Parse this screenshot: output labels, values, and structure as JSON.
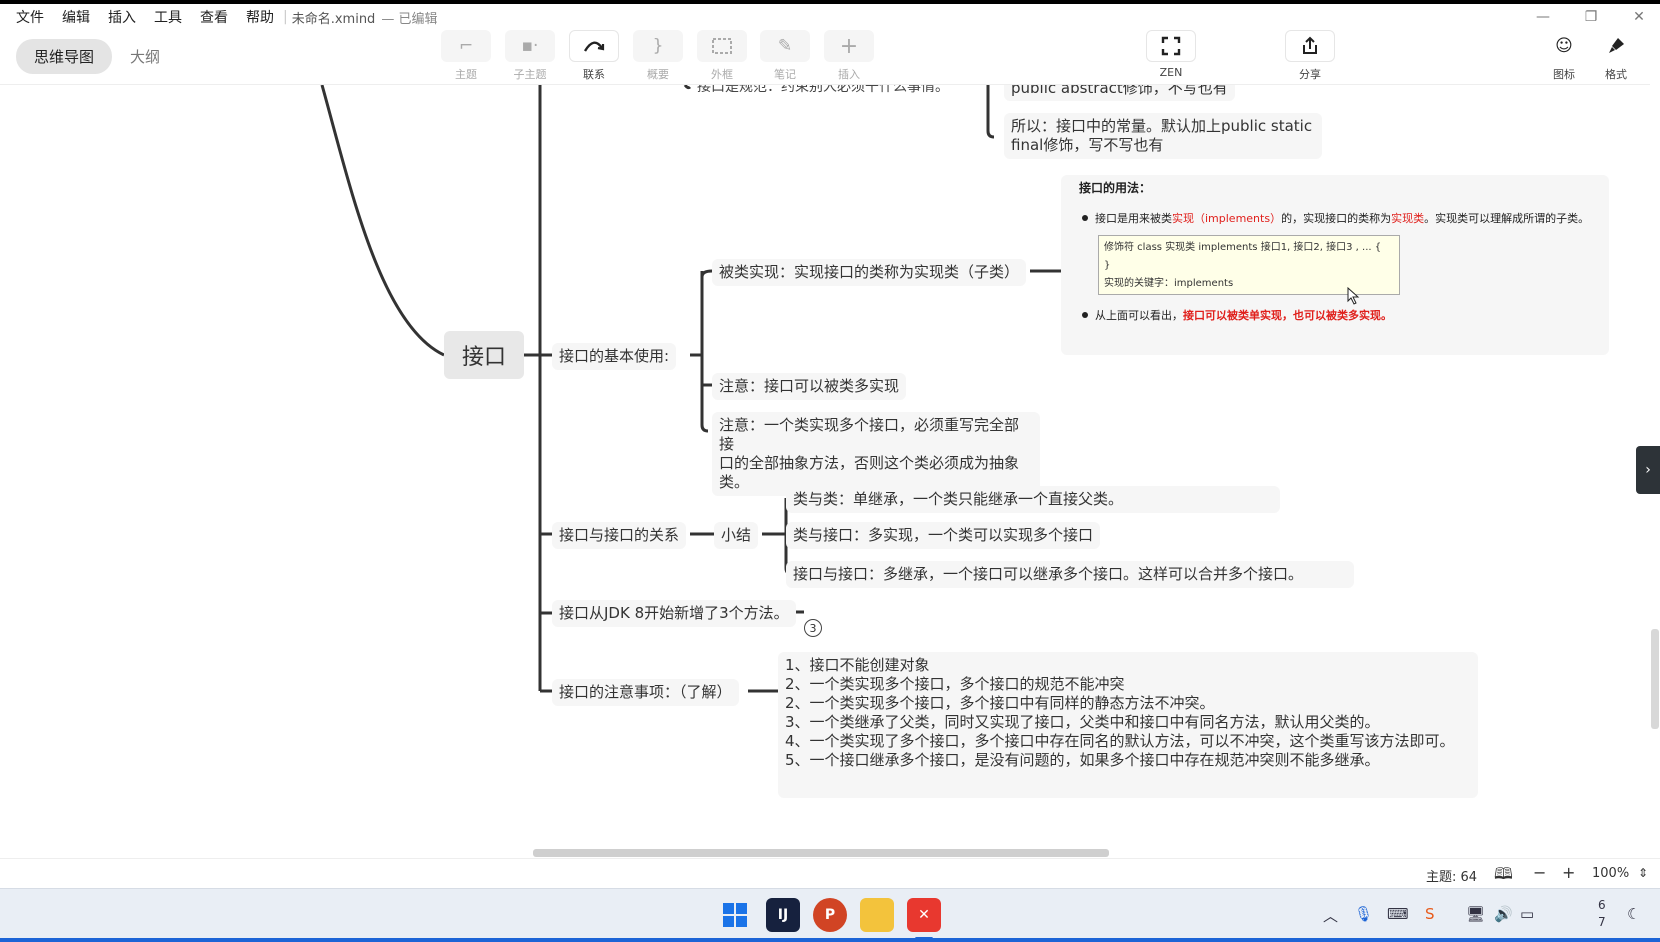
{
  "menu": {
    "items": [
      "文件",
      "编辑",
      "插入",
      "工具",
      "查看",
      "帮助"
    ],
    "filename": "未命名.xmind",
    "status": "— 已编辑"
  },
  "window_controls": {
    "minimize": "—",
    "maximize": "❐",
    "close": "✕"
  },
  "view_switch": {
    "mindmap": "思维导图",
    "outline": "大纲"
  },
  "toolbar": {
    "topic": "主题",
    "subtopic": "子主题",
    "relation": "联系",
    "summary": "概要",
    "boundary": "外框",
    "note": "笔记",
    "insert": "插入",
    "zen": "ZEN",
    "share": "分享",
    "icon": "图标",
    "format": "格式"
  },
  "map": {
    "central": "接口",
    "top_partial_1": "接口是规范：约束别人必须干什么事情。",
    "top_partial_2": "public abstract修饰，不写也有",
    "top_constant_1": "所以：接口中的常量。默认加上public static",
    "top_constant_2": "final修饰，写不写也有",
    "basic_use": "接口的基本使用:",
    "implemented": "被类实现：实现接口的类称为实现类（子类）",
    "attention_1": "注意：接口可以被类多实现",
    "attention_2_l1": "注意：一个类实现多个接口，必须重写完全部接",
    "attention_2_l2": "口的全部抽象方法，否则这个类必须成为抽象",
    "attention_2_l3": "类。",
    "relation": "接口与接口的关系",
    "summary": "小结",
    "rel_class_class": "类与类：单继承，一个类只能继承一个直接父类。",
    "rel_class_iface": "类与接口：多实现，一个类可以实现多个接口",
    "rel_iface_iface": "接口与接口：多继承，一个接口可以继承多个接口。这样可以合并多个接口。",
    "jdk8": "接口从JDK 8开始新增了3个方法。",
    "jdk8_count": "3",
    "notes_title": "接口的注意事项：（了解）",
    "notes_lines": [
      "1、接口不能创建对象",
      "2、一个类实现多个接口，多个接口的规范不能冲突",
      "2、一个类实现多个接口，多个接口中有同样的静态方法不冲突。",
      "3、一个类继承了父类，同时又实现了接口，父类中和接口中有同名方法，默认用父类的。",
      "4、一个类实现了多个接口，多个接口中存在同名的默认方法，可以不冲突，这个类重写该方法即可。",
      "5、一个接口继承多个接口，是没有问题的，如果多个接口中存在规范冲突则不能多继承。"
    ]
  },
  "note_image": {
    "heading": "接口的用法：",
    "b1_pre": "接口是用来被类",
    "b1_red1": "实现（implements）",
    "b1_mid": "的，实现接口的类称为",
    "b1_red2": "实现类",
    "b1_post": "。实现类可以理解成所谓的子类。",
    "code_l1": "修饰符 class 实现类 implements 接口1, 接口2, 接口3 , ... {",
    "code_l2": "}",
    "code_l3": "实现的关键字：implements",
    "b2_pre": "从上面可以看出，",
    "b2_red": "接口可以被类单实现，也可以被类多实现。"
  },
  "statusbar": {
    "topic_count": "主题: 64",
    "zoom": "100%"
  },
  "taskbar": {
    "clock_1": "6",
    "clock_2": "7"
  },
  "colors": {
    "accent_red": "#e0201c",
    "taskbar_blue": "#1c64d6",
    "xmind_red": "#e8382f"
  }
}
